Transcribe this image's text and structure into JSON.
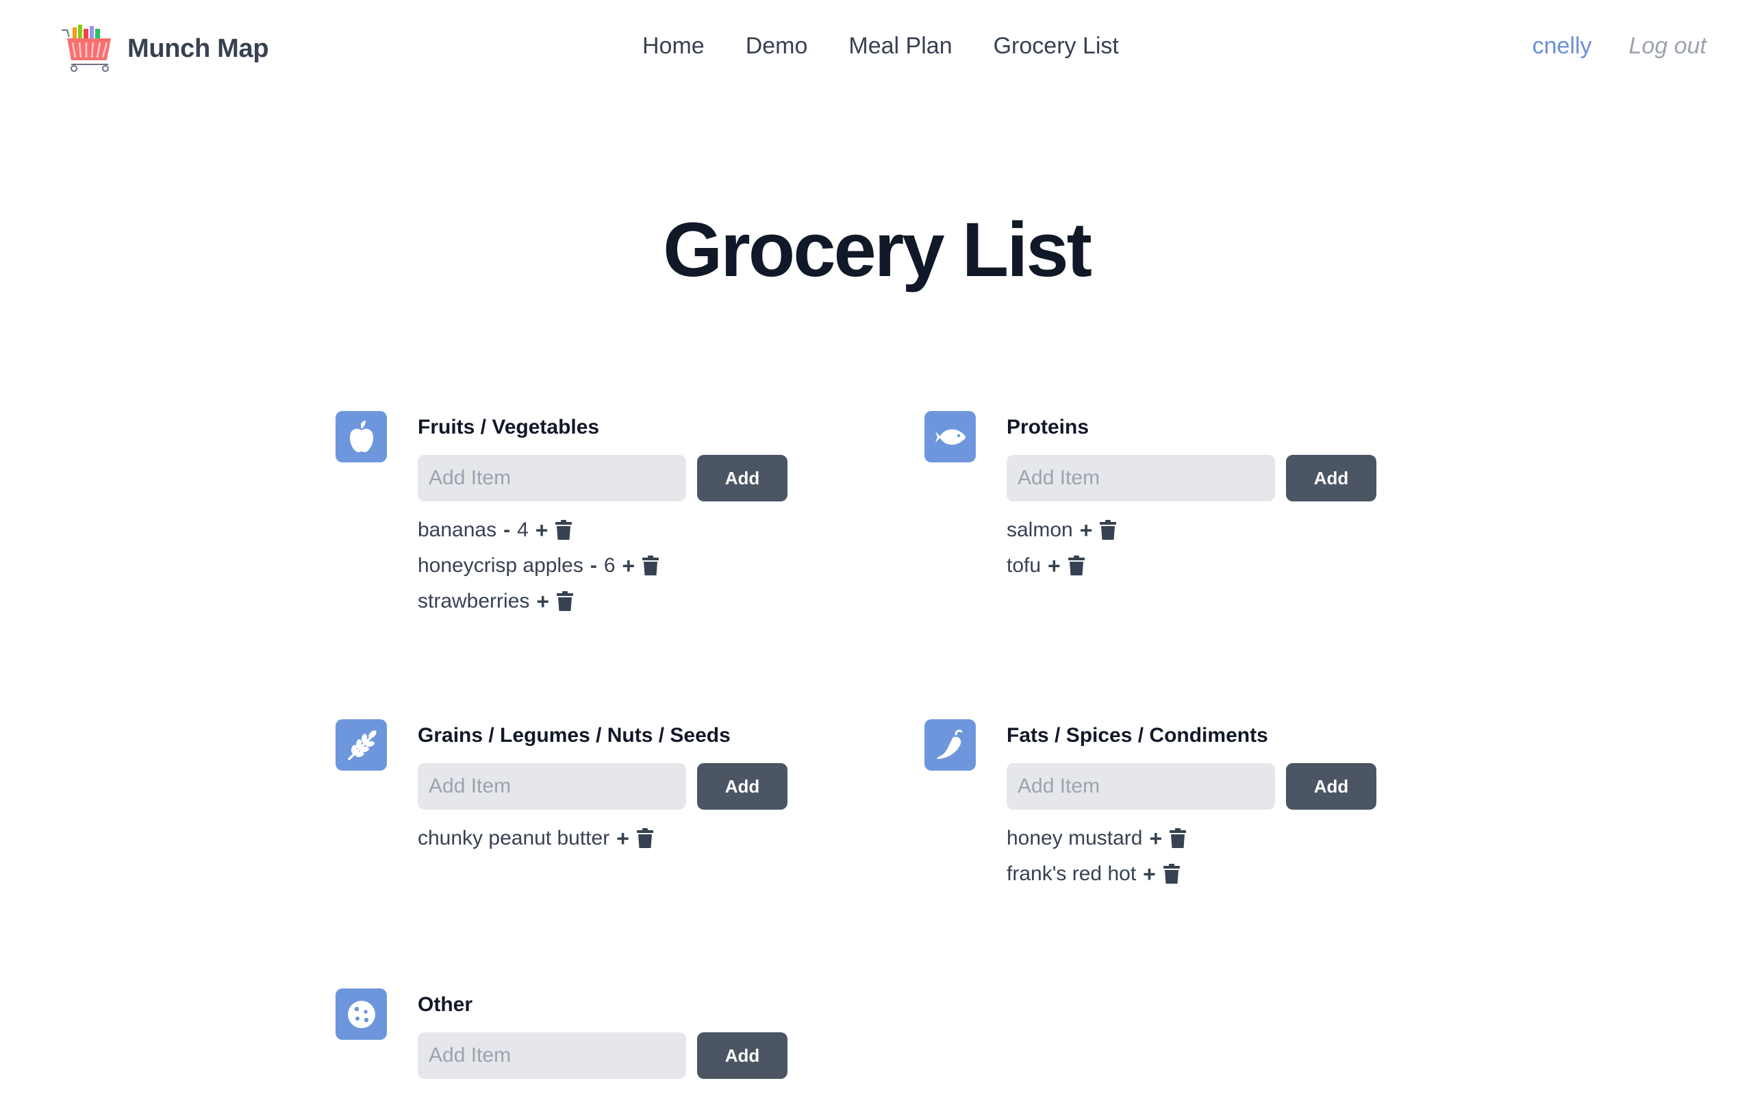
{
  "brand": {
    "name": "Munch Map"
  },
  "nav": {
    "items": [
      "Home",
      "Demo",
      "Meal Plan",
      "Grocery List"
    ]
  },
  "user": {
    "username": "cnelly",
    "logout": "Log out"
  },
  "page": {
    "title": "Grocery List"
  },
  "colors": {
    "icon_bg": "#6d96dd",
    "button_bg": "#4b5563",
    "username": "#6b8fd6",
    "input_bg": "#e5e7eb"
  },
  "categories": [
    {
      "title": "Fruits / Vegetables",
      "icon": "apple-icon",
      "placeholder": "Add Item",
      "button": "Add",
      "items": [
        {
          "name": "bananas",
          "sep": "-",
          "qty": "4"
        },
        {
          "name": "honeycrisp apples",
          "sep": "-",
          "qty": "6"
        },
        {
          "name": "strawberries",
          "sep": "",
          "qty": ""
        }
      ]
    },
    {
      "title": "Proteins",
      "icon": "fish-icon",
      "placeholder": "Add Item",
      "button": "Add",
      "items": [
        {
          "name": "salmon",
          "sep": "",
          "qty": ""
        },
        {
          "name": "tofu",
          "sep": "",
          "qty": ""
        }
      ]
    },
    {
      "title": "Grains / Legumes / Nuts / Seeds",
      "icon": "wheat-icon",
      "placeholder": "Add Item",
      "button": "Add",
      "items": [
        {
          "name": "chunky peanut butter",
          "sep": "",
          "qty": ""
        }
      ]
    },
    {
      "title": "Fats / Spices / Condiments",
      "icon": "pepper-icon",
      "placeholder": "Add Item",
      "button": "Add",
      "items": [
        {
          "name": "honey mustard",
          "sep": "",
          "qty": ""
        },
        {
          "name": "frank's red hot",
          "sep": "",
          "qty": ""
        }
      ]
    },
    {
      "title": "Other",
      "icon": "cookie-icon",
      "placeholder": "Add Item",
      "button": "Add",
      "items": []
    }
  ],
  "item_controls": {
    "increment": "+"
  }
}
